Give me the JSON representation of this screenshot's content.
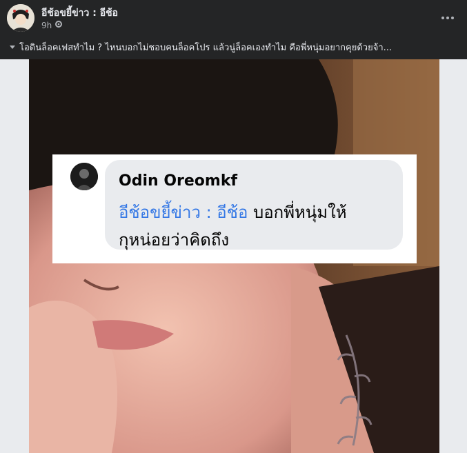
{
  "post": {
    "page_name": "อีช้อขยี้ข่าว : อีช้อ",
    "time": "9h",
    "caption": "โอดินล็อคเฟสทำไม ? ไหนบอกไม่ชอบคนล็อคโปร แล้วนู่ล็อคเองทำไม คือพี่หนุ่มอยากคุยด้วยจ้า..."
  },
  "comment": {
    "name": "Odin Oreomkf",
    "mention": "อีช้อขยี้ข่าว : อีช้อ",
    "text_inline": " บอกพี่หนุ่มให้",
    "text_line2": "กุหน่อยว่าคิดถึง"
  },
  "icons": {
    "privacy": "gear-icon",
    "more": "more-icon",
    "caret": "caret-down-icon"
  },
  "colors": {
    "background": "#242526",
    "mention": "#3578e5",
    "bubble": "#e9ebee"
  }
}
